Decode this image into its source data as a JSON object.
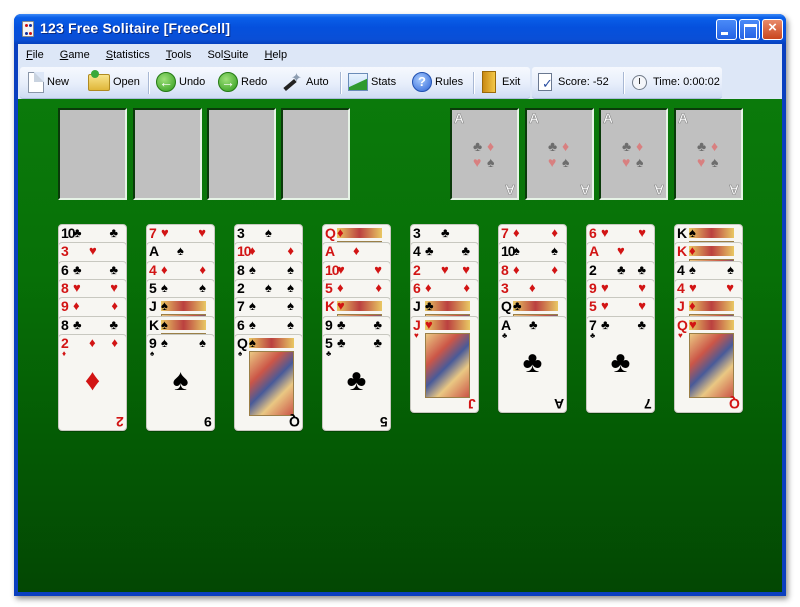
{
  "window": {
    "title": "123 Free Solitaire  [FreeCell]",
    "controls": {
      "minimize": "minimize",
      "maximize": "maximize",
      "close": "×"
    }
  },
  "menu": [
    {
      "label": "File",
      "accel": "F",
      "rest": "ile"
    },
    {
      "label": "Game",
      "accel": "G",
      "rest": "ame"
    },
    {
      "label": "Statistics",
      "accel": "S",
      "rest": "tatistics"
    },
    {
      "label": "Tools",
      "accel": "T",
      "rest": "ools"
    },
    {
      "label": "SolSuite",
      "pre": "Sol",
      "accel": "S",
      "rest": "uite"
    },
    {
      "label": "Help",
      "accel": "H",
      "rest": "elp"
    }
  ],
  "toolbar": {
    "new": "New",
    "open": "Open",
    "undo": "Undo",
    "redo": "Redo",
    "auto": "Auto",
    "stats": "Stats",
    "rules": "Rules",
    "exit": "Exit",
    "score": "Score: -52",
    "time": "Time: 0:00:02",
    "icons": {
      "new": "new-document-icon",
      "open": "open-folder-icon",
      "undo": "undo-arrow-icon",
      "redo": "redo-arrow-icon",
      "auto": "magic-wand-icon",
      "stats": "chart-icon",
      "rules": "help-question-icon",
      "exit": "door-icon",
      "score": "scorecard-icon",
      "time": "stopwatch-icon"
    },
    "glyphs": {
      "undo": "←",
      "redo": "→",
      "rules": "?"
    }
  },
  "board": {
    "felt_color": "#077007",
    "free_cells": [
      {
        "card": null
      },
      {
        "card": null
      },
      {
        "card": null
      },
      {
        "card": null
      }
    ],
    "foundations": [
      {
        "placeholder": "A",
        "card": null
      },
      {
        "placeholder": "A",
        "card": null
      },
      {
        "placeholder": "A",
        "card": null
      },
      {
        "placeholder": "A",
        "card": null
      }
    ],
    "foundation_pips": [
      "♣",
      "♦",
      "♥",
      "♠"
    ],
    "tableau": [
      [
        {
          "rank": "10",
          "suit": "♣"
        },
        {
          "rank": "3",
          "suit": "♥"
        },
        {
          "rank": "6",
          "suit": "♣"
        },
        {
          "rank": "8",
          "suit": "♥"
        },
        {
          "rank": "9",
          "suit": "♦"
        },
        {
          "rank": "8",
          "suit": "♣"
        },
        {
          "rank": "2",
          "suit": "♦"
        }
      ],
      [
        {
          "rank": "7",
          "suit": "♥"
        },
        {
          "rank": "A",
          "suit": "♠"
        },
        {
          "rank": "4",
          "suit": "♦"
        },
        {
          "rank": "5",
          "suit": "♠"
        },
        {
          "rank": "J",
          "suit": "♠"
        },
        {
          "rank": "K",
          "suit": "♠"
        },
        {
          "rank": "9",
          "suit": "♠"
        }
      ],
      [
        {
          "rank": "3",
          "suit": "♠"
        },
        {
          "rank": "10",
          "suit": "♦"
        },
        {
          "rank": "8",
          "suit": "♠"
        },
        {
          "rank": "2",
          "suit": "♠"
        },
        {
          "rank": "7",
          "suit": "♠"
        },
        {
          "rank": "6",
          "suit": "♠"
        },
        {
          "rank": "Q",
          "suit": "♠"
        }
      ],
      [
        {
          "rank": "Q",
          "suit": "♦"
        },
        {
          "rank": "A",
          "suit": "♦"
        },
        {
          "rank": "10",
          "suit": "♥"
        },
        {
          "rank": "5",
          "suit": "♦"
        },
        {
          "rank": "K",
          "suit": "♥"
        },
        {
          "rank": "9",
          "suit": "♣"
        },
        {
          "rank": "5",
          "suit": "♣"
        }
      ],
      [
        {
          "rank": "3",
          "suit": "♣"
        },
        {
          "rank": "4",
          "suit": "♣"
        },
        {
          "rank": "2",
          "suit": "♥"
        },
        {
          "rank": "6",
          "suit": "♦"
        },
        {
          "rank": "J",
          "suit": "♣"
        },
        {
          "rank": "J",
          "suit": "♥"
        }
      ],
      [
        {
          "rank": "7",
          "suit": "♦"
        },
        {
          "rank": "10",
          "suit": "♠"
        },
        {
          "rank": "8",
          "suit": "♦"
        },
        {
          "rank": "3",
          "suit": "♦"
        },
        {
          "rank": "Q",
          "suit": "♣"
        },
        {
          "rank": "A",
          "suit": "♣"
        }
      ],
      [
        {
          "rank": "6",
          "suit": "♥"
        },
        {
          "rank": "A",
          "suit": "♥"
        },
        {
          "rank": "2",
          "suit": "♣"
        },
        {
          "rank": "9",
          "suit": "♥"
        },
        {
          "rank": "5",
          "suit": "♥"
        },
        {
          "rank": "7",
          "suit": "♣"
        }
      ],
      [
        {
          "rank": "K",
          "suit": "♠"
        },
        {
          "rank": "K",
          "suit": "♦"
        },
        {
          "rank": "4",
          "suit": "♠"
        },
        {
          "rank": "4",
          "suit": "♥"
        },
        {
          "rank": "J",
          "suit": "♦"
        },
        {
          "rank": "Q",
          "suit": "♥"
        }
      ]
    ]
  }
}
